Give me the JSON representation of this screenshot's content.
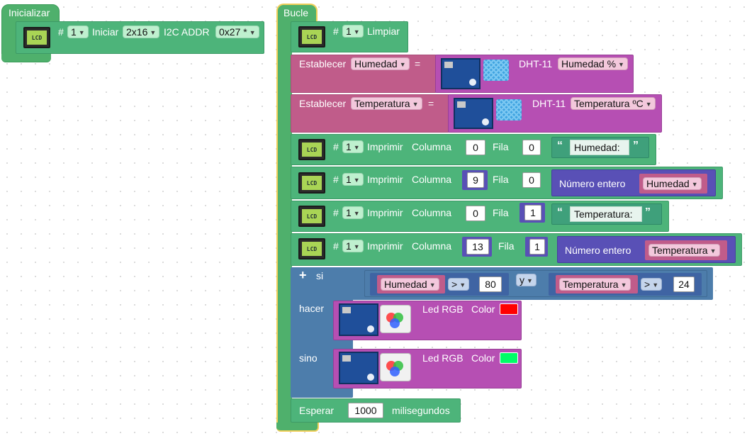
{
  "init": {
    "title": "Inicializar",
    "lcd_text": "LCD",
    "hash": "#",
    "lcd_index": "1",
    "iniciar": "Iniciar",
    "size": "2x16",
    "i2c_label": "I2C ADDR",
    "addr": "0x27 *"
  },
  "loop": {
    "title": "Bucle",
    "limpiar": {
      "hash": "#",
      "index": "1",
      "label": "Limpiar"
    },
    "set_hum": {
      "label": "Establecer",
      "var": "Humedad",
      "eq": "=",
      "sensor": "DHT-11",
      "reading": "Humedad %"
    },
    "set_temp": {
      "label": "Establecer",
      "var": "Temperatura",
      "eq": "=",
      "sensor": "DHT-11",
      "reading": "Temperatura ºC"
    },
    "print1": {
      "hash": "#",
      "index": "1",
      "imprimir": "Imprimir",
      "columna": "Columna",
      "col": "0",
      "fila": "Fila",
      "row": "0",
      "text": "Humedad:"
    },
    "print2": {
      "hash": "#",
      "index": "1",
      "imprimir": "Imprimir",
      "columna": "Columna",
      "col": "9",
      "fila": "Fila",
      "row": "0",
      "num_label": "Número entero",
      "var": "Humedad"
    },
    "print3": {
      "hash": "#",
      "index": "1",
      "imprimir": "Imprimir",
      "columna": "Columna",
      "col": "0",
      "fila": "Fila",
      "row": "1",
      "text": "Temperatura:"
    },
    "print4": {
      "hash": "#",
      "index": "1",
      "imprimir": "Imprimir",
      "columna": "Columna",
      "col": "13",
      "fila": "Fila",
      "row": "1",
      "num_label": "Número entero",
      "var": "Temperatura"
    },
    "if": {
      "plus": "+",
      "si": "si",
      "cond1_var": "Humedad",
      "cond1_op": ">",
      "cond1_val": "80",
      "and": "y",
      "cond2_var": "Temperatura",
      "cond2_op": ">",
      "cond2_val": "24",
      "hacer": "hacer",
      "sino": "sino",
      "led1": {
        "label": "Led RGB",
        "color_label": "Color",
        "color": "#ff0000"
      },
      "led2": {
        "label": "Led RGB",
        "color_label": "Color",
        "color": "#00ff66"
      }
    },
    "wait": {
      "label": "Esperar",
      "value": "1000",
      "unit": "milisegundos"
    }
  }
}
